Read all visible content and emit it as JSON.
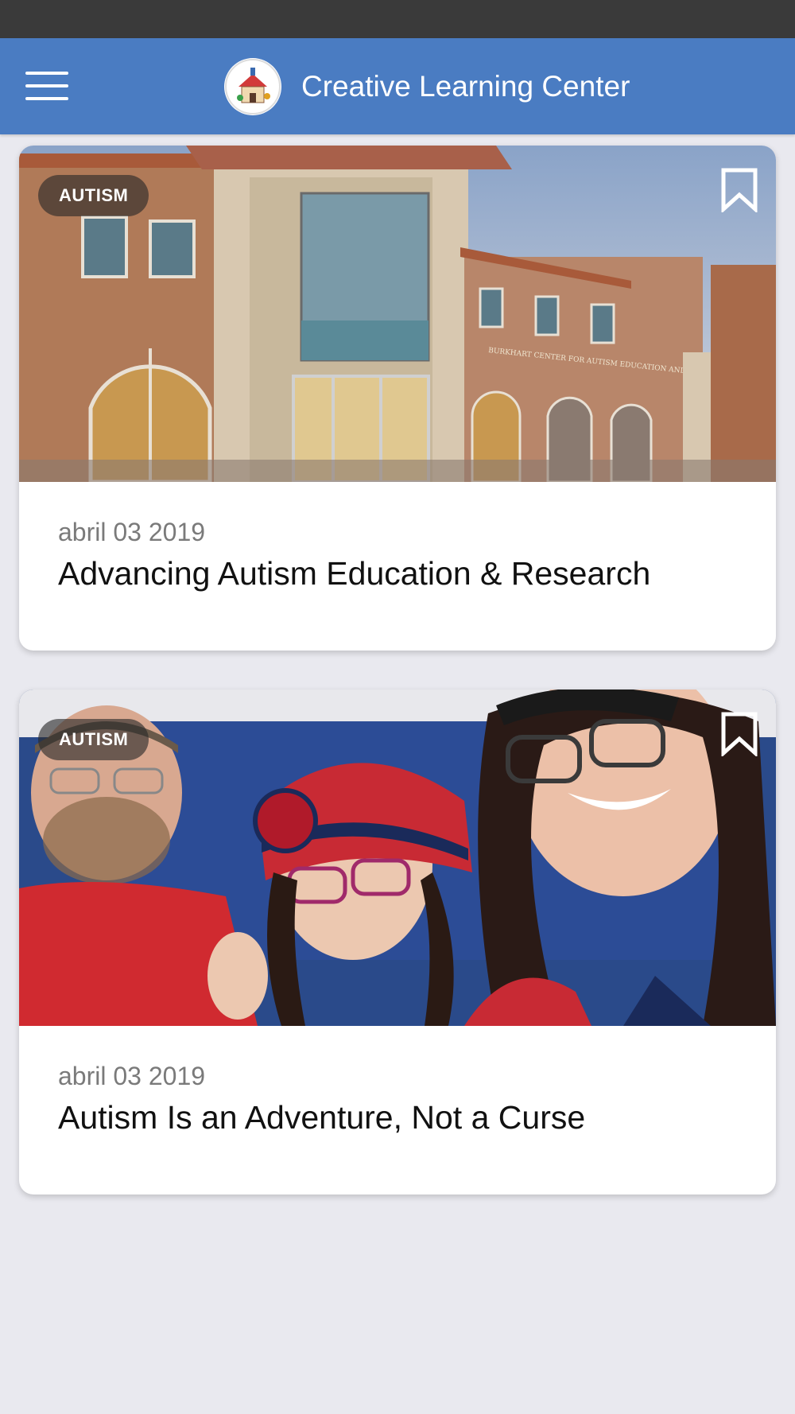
{
  "header": {
    "title": "Creative Learning Center",
    "logo_icon": "schoolhouse-logo-icon",
    "menu_icon": "hamburger-menu-icon",
    "color": "#4a7cc2"
  },
  "articles": [
    {
      "tag": "AUTISM",
      "date": "abril 03 2019",
      "title": "Advancing Autism Education & Research",
      "bookmark_icon": "bookmark-icon",
      "image": "photo of brick school building",
      "building_sign": "BURKHART CENTER FOR AUTISM EDUCATION AND RESEARCH"
    },
    {
      "tag": "AUTISM",
      "date": "abril 03 2019",
      "title": "Autism Is an Adventure, Not a Curse",
      "bookmark_icon": "bookmark-icon",
      "image": "family selfie at hockey game"
    }
  ],
  "colors": {
    "background": "#e9e9ef",
    "status_bar": "#3a3a3a"
  }
}
